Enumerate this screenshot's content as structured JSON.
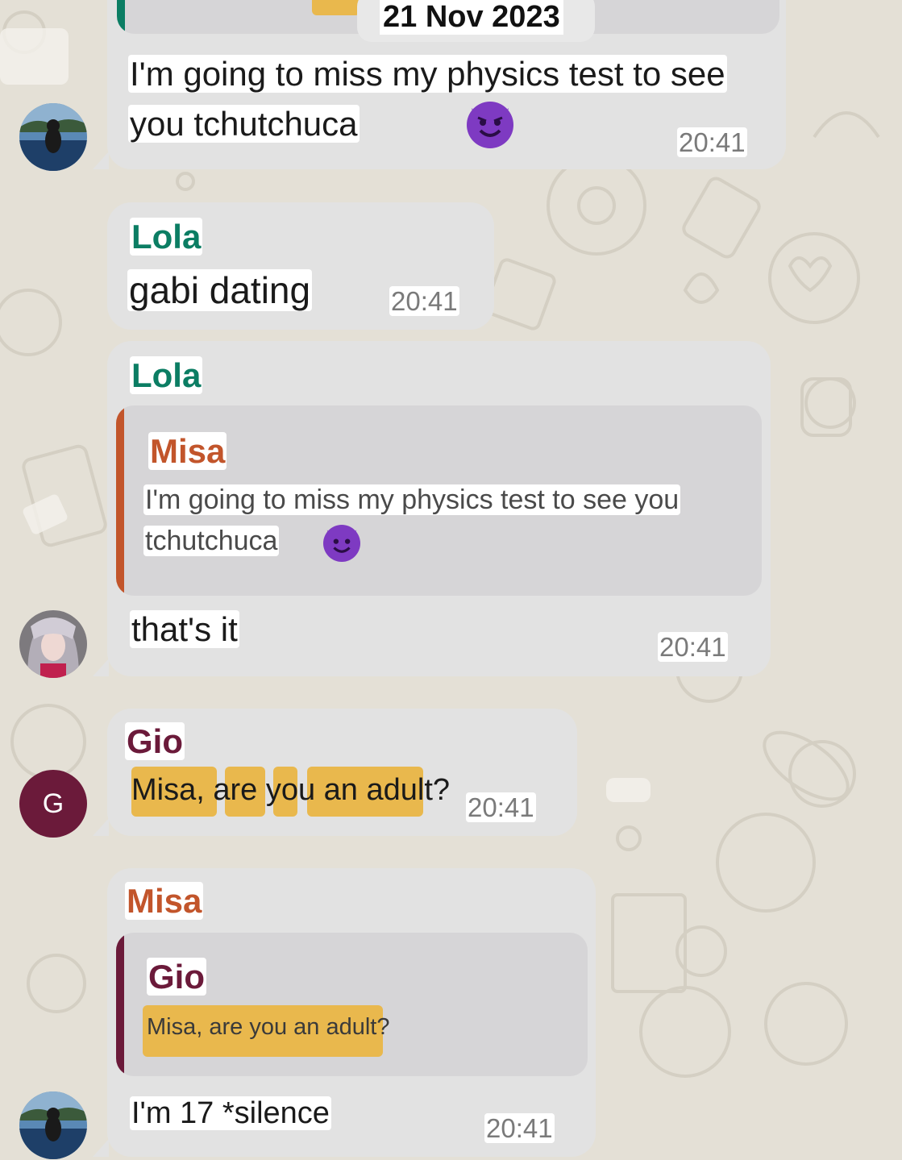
{
  "date_chip": "21 Nov 2023",
  "messages": [
    {
      "text_line1": "I'm going to miss my physics test to see",
      "text_line2": "you tchutchuca",
      "emoji": "smiling-imp-emoji",
      "time": "20:41"
    },
    {
      "sender": "Lola",
      "text": "gabi dating",
      "time": "20:41"
    },
    {
      "sender": "Lola",
      "quote": {
        "sender": "Misa",
        "line1": "I'm going to miss my physics test to see you",
        "line2": "tchutchuca",
        "emoji": "smiling-imp-emoji"
      },
      "text": "that's it",
      "time": "20:41"
    },
    {
      "sender": "Gio",
      "avatar_letter": "G",
      "text": "Misa, are you an adult?",
      "time": "20:41"
    },
    {
      "sender": "Misa",
      "quote": {
        "sender": "Gio",
        "line1": "Misa, are you an adult?"
      },
      "text": "I'm 17 *silence",
      "time": "20:41"
    }
  ],
  "colors": {
    "lola": "#0b7d63",
    "misa": "#c2552b",
    "gio": "#6b1a3a",
    "bubble": "#e2e2e2",
    "wallpaper": "#e4e0d6",
    "search_highlight": "#e9b84d"
  }
}
